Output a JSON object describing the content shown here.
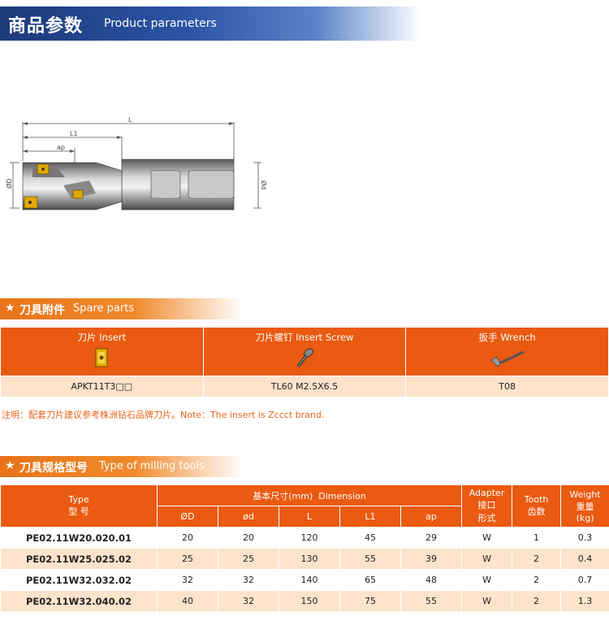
{
  "header": {
    "title_cn": "商品参数",
    "title_en": "Product parameters"
  },
  "drawing": {
    "label_L": "L",
    "label_L1": "L1",
    "label_ap": "ap",
    "label_D": "ØD",
    "label_d": "Ød"
  },
  "spare_section": {
    "title_cn": "刀具附件",
    "title_en": "Spare parts"
  },
  "spare_table": {
    "columns": [
      {
        "cn": "刀片",
        "en": "Insert",
        "icon": "insert-icon",
        "value": "APKT11T3□□"
      },
      {
        "cn": "刀片螺钉",
        "en": "Insert Screw",
        "icon": "screw-icon",
        "value": "TL60 M2.5X6.5"
      },
      {
        "cn": "扳手",
        "en": "Wrench",
        "icon": "wrench-icon",
        "value": "T08"
      }
    ]
  },
  "note": "注明：配套刀片建议参考株洲钻石品牌刀片。Note：The insert is Zccct brand.",
  "mill_section": {
    "title_cn": "刀具规格型号",
    "title_en": "Type of milling tools"
  },
  "mill_table": {
    "type_en": "Type",
    "type_cn": "型 号",
    "dim_cn": "基本尺寸(mm)",
    "dim_en": "Dimension",
    "sub": [
      "ØD",
      "ød",
      "L",
      "L1",
      "ap"
    ],
    "adapter": [
      "Adapter",
      "接口",
      "形式"
    ],
    "tooth": [
      "Tooth",
      "齿数"
    ],
    "weight": [
      "Weight",
      "重量",
      "(kg)"
    ],
    "rows": [
      [
        "PE02.11W20.020.01",
        "20",
        "20",
        "120",
        "45",
        "29",
        "W",
        "1",
        "0.3"
      ],
      [
        "PE02.11W25.025.02",
        "25",
        "25",
        "130",
        "55",
        "39",
        "W",
        "2",
        "0.4"
      ],
      [
        "PE02.11W32.032.02",
        "32",
        "32",
        "140",
        "65",
        "48",
        "W",
        "2",
        "0.7"
      ],
      [
        "PE02.11W32.040.02",
        "40",
        "32",
        "150",
        "75",
        "55",
        "W",
        "2",
        "1.3"
      ]
    ]
  }
}
